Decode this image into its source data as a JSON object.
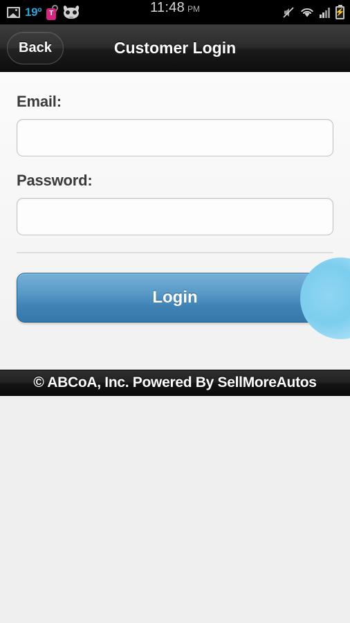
{
  "status_bar": {
    "temperature": "19º",
    "clock_time": "11:48",
    "clock_ampm": "PM",
    "tmobile_letter": "T",
    "battery_glyph": "⚡",
    "icons": {
      "photo": "photo-icon",
      "tmobile": "tmobile-tag-icon",
      "cyanogen": "cyanogenmod-icon",
      "mute": "mute-icon",
      "wifi": "wifi-icon",
      "signal": "cellular-signal-icon",
      "battery": "battery-charging-icon"
    }
  },
  "title_bar": {
    "back_label": "Back",
    "title": "Customer Login"
  },
  "form": {
    "email_label": "Email:",
    "email_value": "",
    "email_placeholder": "",
    "password_label": "Password:",
    "password_value": "",
    "password_placeholder": "",
    "login_label": "Login"
  },
  "footer": {
    "text": "© ABCoA, Inc. Powered By SellMoreAutos"
  },
  "colors": {
    "accent_blue": "#5a9bc9",
    "temp_blue": "#2aa4d6",
    "tmobile_magenta": "#d6257f",
    "bar_black": "#000000",
    "page_gray": "#efeff0"
  }
}
